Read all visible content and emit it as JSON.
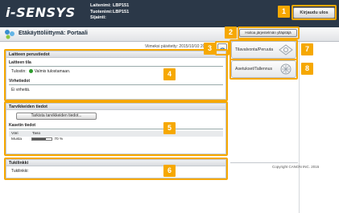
{
  "header": {
    "logo": "i-SENSYS",
    "device": [
      {
        "key": "Laitenimi:",
        "value": "LBP151"
      },
      {
        "key": "Tuotenimi:",
        "value": "LBP151"
      },
      {
        "key": "Sijainti:",
        "value": ""
      }
    ],
    "logout_label": "Kirjaudu ulos"
  },
  "title": "Etäkäyttöliittymä: Portaali",
  "updated_text": "Viimeksi päivitetty: 2015/10/10 20:1",
  "portal_button_label": "Hoitoa järjestelmän ylläpitäjä",
  "device_info": {
    "heading": "Laitteen perustiedot",
    "state_heading": "Laitteen tila",
    "printer_key": "Tulostin:",
    "printer_status": "Valmis tulostamaan.",
    "error_heading": "Virhetiedot",
    "error_text": "Ei virheitä."
  },
  "consumables": {
    "heading": "Tarvikkeiden tiedot",
    "check_button": "Tarkista tarvikkeiden tiedot...",
    "cartridge_heading": "Kasetin tiedot",
    "columns": [
      "Väri",
      "Taso"
    ],
    "rows": [
      {
        "color": "Musta",
        "level_text": "70 %",
        "level_fraction": 0.7
      }
    ]
  },
  "support": {
    "heading": "Tukilinkki",
    "label": "Tukilinkki:"
  },
  "side_menu": [
    {
      "label": "Tilavalvonta/Peruuta",
      "icon": "monitor-icon"
    },
    {
      "label": "Asetukset/Tallennus",
      "icon": "settings-icon"
    }
  ],
  "copyright": "Copyright CANON INC. 2015",
  "callouts": [
    "1",
    "2",
    "3",
    "4",
    "5",
    "6",
    "7",
    "8"
  ],
  "colors": {
    "header_bg": "#2b3848",
    "callout": "#f6a800",
    "status_ok": "#2e9b2e"
  }
}
